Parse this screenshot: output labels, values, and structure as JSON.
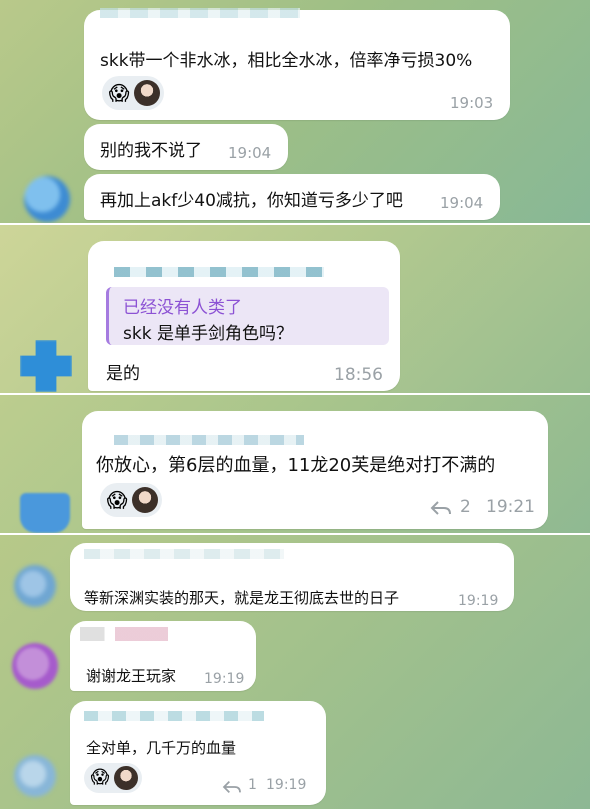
{
  "messages": [
    {
      "text": "skk带一个非水冰，相比全水冰，倍率净亏损30%",
      "time": "19:03",
      "reaction_emoji": "😱"
    },
    {
      "text": "别的我不说了",
      "time": "19:04"
    },
    {
      "text": "再加上akf少40减抗，你知道亏多少了吧",
      "time": "19:04"
    },
    {
      "quote_title": "已经没有人类了",
      "quote_text": "skk 是单手剑角色吗？",
      "text": "是的",
      "time": "18:56"
    },
    {
      "text": "你放心，第6层的血量，11龙20芙是绝对打不满的",
      "time": "19:21",
      "reaction_emoji": "😱",
      "replies": "2"
    },
    {
      "text": "等新深渊实装的那天，就是龙王彻底去世的日子",
      "time": "19:19"
    },
    {
      "text": "谢谢龙王玩家",
      "time": "19:19"
    },
    {
      "text": "全对单，几千万的血量",
      "time": "19:19",
      "reaction_emoji": "😱",
      "replies": "1"
    }
  ],
  "icons": {
    "reply": "reply-arrow-icon"
  },
  "colors": {
    "bubble": "#ffffff",
    "time": "#9aa1a6",
    "quote_accent": "#a57be0",
    "reaction_bg": "#e9eef2"
  }
}
